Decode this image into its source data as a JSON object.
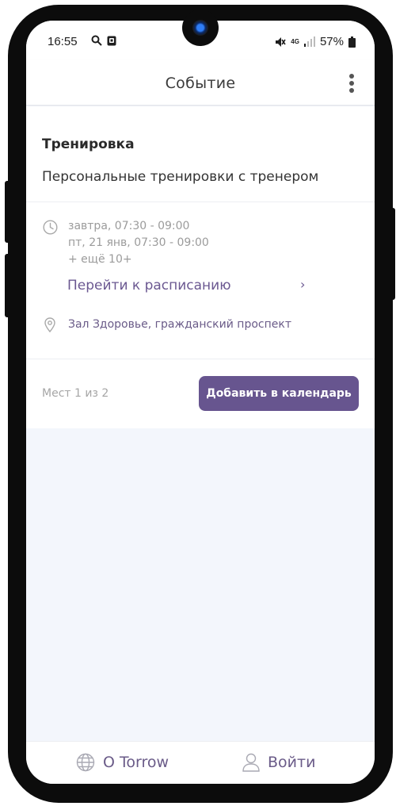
{
  "status_bar": {
    "time": "16:55",
    "signal_label": "4G",
    "battery": "57%"
  },
  "header": {
    "title": "Событие"
  },
  "event": {
    "type": "Тренировка",
    "title": "Персональные тренировки с тренером",
    "dates": [
      "завтра, 07:30 - 09:00",
      "пт, 21 янв, 07:30 - 09:00",
      "+ ещё 10+"
    ],
    "schedule_link": "Перейти к расписанию",
    "location": "Зал Здоровье, гражданский проспект",
    "seats": "Мест 1 из 2",
    "add_button": "Добавить в календарь"
  },
  "bottom_nav": {
    "about": "О Torrow",
    "login": "Войти"
  },
  "colors": {
    "accent": "#67558f",
    "link": "#6b5891",
    "background": "#f3f6fc"
  }
}
